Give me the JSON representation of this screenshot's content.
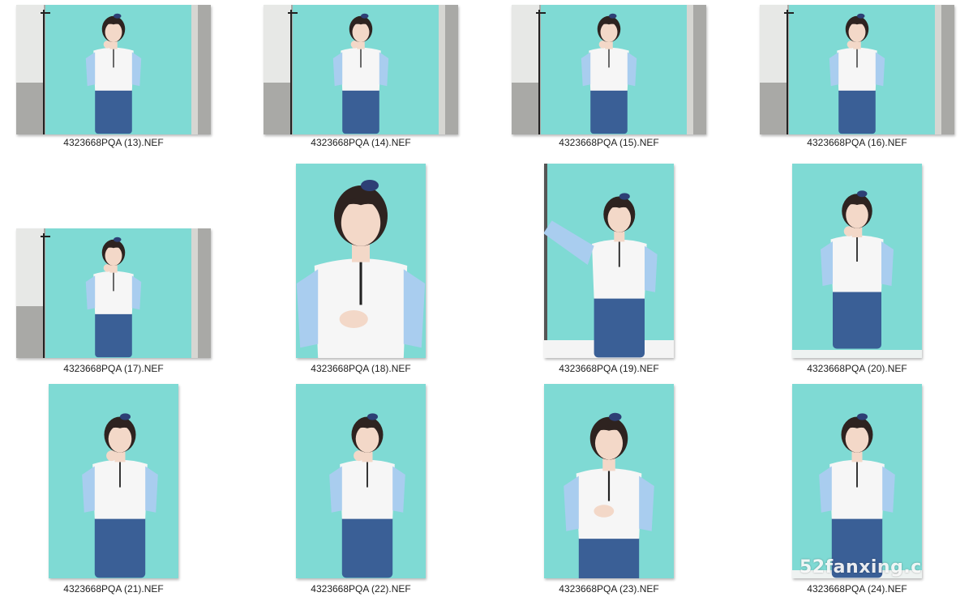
{
  "explorer": {
    "view": "Large icons",
    "files": [
      {
        "name": "4323668PQA (13).NEF",
        "orientation": "landscape",
        "scene": "studio-wide"
      },
      {
        "name": "4323668PQA (14).NEF",
        "orientation": "landscape",
        "scene": "studio-wide"
      },
      {
        "name": "4323668PQA (15).NEF",
        "orientation": "landscape",
        "scene": "studio-wide"
      },
      {
        "name": "4323668PQA (16).NEF",
        "orientation": "landscape",
        "scene": "studio-wide"
      },
      {
        "name": "4323668PQA (17).NEF",
        "orientation": "landscape",
        "scene": "studio-wide"
      },
      {
        "name": "4323668PQA (18).NEF",
        "orientation": "portrait",
        "scene": "close-up"
      },
      {
        "name": "4323668PQA (19).NEF",
        "orientation": "portrait",
        "scene": "arm-raised"
      },
      {
        "name": "4323668PQA (20).NEF",
        "orientation": "portrait",
        "scene": "hand-cheek"
      },
      {
        "name": "4323668PQA (21).NEF",
        "orientation": "portrait",
        "scene": "hand-chin"
      },
      {
        "name": "4323668PQA (22).NEF",
        "orientation": "portrait",
        "scene": "hand-chin"
      },
      {
        "name": "4323668PQA (23).NEF",
        "orientation": "portrait",
        "scene": "half-body"
      },
      {
        "name": "4323668PQA (24).NEF",
        "orientation": "portrait",
        "scene": "standing"
      }
    ]
  },
  "watermark": "52fanxing.c",
  "colors": {
    "backdrop": "#7fdad4",
    "backdrop_edge": "#63c9c2",
    "sleeve": "#a9cdef",
    "shirt": "#f6f6f6",
    "jeans": "#3a5f96",
    "hair": "#2e2320",
    "skin": "#f3d8c8",
    "stand_panel": "#e7e8e6",
    "wall_gray": "#a9a9a6"
  }
}
